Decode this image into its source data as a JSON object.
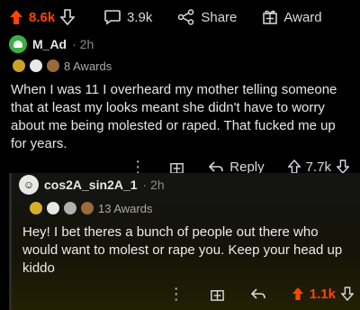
{
  "top_bar": {
    "upvotes": "8.6k",
    "comments": "3.9k",
    "share_label": "Share",
    "award_label": "Award"
  },
  "comment": {
    "author": "M_Ad",
    "time": "· 2h",
    "awards": "8 Awards",
    "text": "When I was 11 I overheard my mother telling someone that at least my looks meant she didn't have to worry about me being molested or raped. That fucked me up for years.",
    "reply_label": "Reply",
    "score": "7.7k"
  },
  "reply": {
    "author": "cos2A_sin2A_1",
    "time": "· 2h",
    "awards": "13 Awards",
    "text": "Hey! I bet theres a bunch of people out there who would want to molest or rape you. Keep your head up kiddo",
    "score": "1.1k"
  },
  "colors": {
    "upvote": "#ff4500",
    "background": "#000000",
    "avatar_green": "#3cb043"
  },
  "icons": [
    "upvote-arrow-icon",
    "downvote-arrow-icon",
    "comment-bubble-icon",
    "share-icon",
    "award-gift-icon",
    "reply-arrow-icon",
    "more-dots-icon"
  ]
}
